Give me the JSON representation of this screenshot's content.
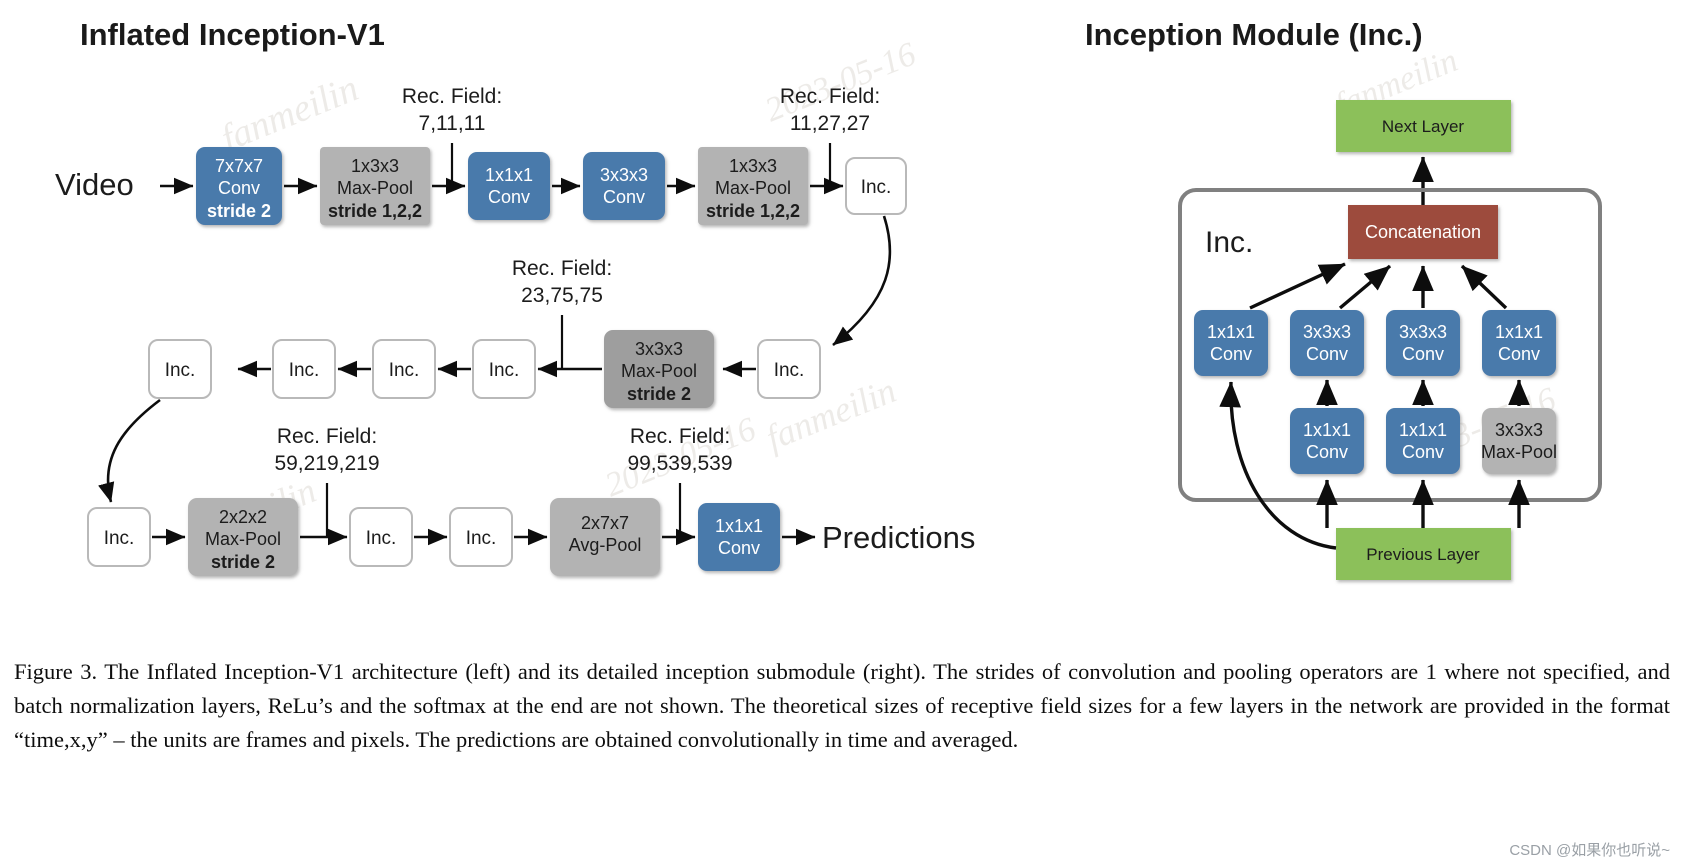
{
  "left_panel": {
    "title": "Inflated Inception-V1",
    "input_label": "Video",
    "output_label": "Predictions",
    "rec_field_caption": "Rec. Field:",
    "rec_fields": [
      {
        "id": "rf1",
        "caption": "Rec. Field:",
        "value": "7,11,11"
      },
      {
        "id": "rf2",
        "caption": "Rec. Field:",
        "value": "11,27,27"
      },
      {
        "id": "rf3",
        "caption": "Rec. Field:",
        "value": "23,75,75"
      },
      {
        "id": "rf4",
        "caption": "Rec. Field:",
        "value": "59,219,219"
      },
      {
        "id": "rf5",
        "caption": "Rec. Field:",
        "value": "99,539,539"
      }
    ],
    "row1": [
      {
        "kind": "conv",
        "l1": "7x7x7",
        "l2": "Conv",
        "l3": "stride 2"
      },
      {
        "kind": "pool",
        "l1": "1x3x3",
        "l2": "Max-Pool",
        "l3": "stride 1,2,2"
      },
      {
        "kind": "conv",
        "l1": "1x1x1",
        "l2": "Conv",
        "l3": ""
      },
      {
        "kind": "conv",
        "l1": "3x3x3",
        "l2": "Conv",
        "l3": ""
      },
      {
        "kind": "pool",
        "l1": "1x3x3",
        "l2": "Max-Pool",
        "l3": "stride 1,2,2"
      },
      {
        "kind": "inc",
        "l1": "Inc.",
        "l2": "",
        "l3": ""
      }
    ],
    "row2": [
      {
        "kind": "inc",
        "l1": "Inc.",
        "l2": "",
        "l3": ""
      },
      {
        "kind": "inc",
        "l1": "Inc.",
        "l2": "",
        "l3": ""
      },
      {
        "kind": "inc",
        "l1": "Inc.",
        "l2": "",
        "l3": ""
      },
      {
        "kind": "inc",
        "l1": "Inc.",
        "l2": "",
        "l3": ""
      },
      {
        "kind": "pool",
        "l1": "3x3x3",
        "l2": "Max-Pool",
        "l3": "stride 2"
      },
      {
        "kind": "inc",
        "l1": "Inc.",
        "l2": "",
        "l3": ""
      }
    ],
    "row3": [
      {
        "kind": "inc",
        "l1": "Inc.",
        "l2": "",
        "l3": ""
      },
      {
        "kind": "pool",
        "l1": "2x2x2",
        "l2": "Max-Pool",
        "l3": "stride 2"
      },
      {
        "kind": "inc",
        "l1": "Inc.",
        "l2": "",
        "l3": ""
      },
      {
        "kind": "inc",
        "l1": "Inc.",
        "l2": "",
        "l3": ""
      },
      {
        "kind": "pool",
        "l1": "2x7x7",
        "l2": "Avg-Pool",
        "l3": ""
      },
      {
        "kind": "conv",
        "l1": "1x1x1",
        "l2": "Conv",
        "l3": ""
      }
    ]
  },
  "right_panel": {
    "title": "Inception Module (Inc.)",
    "next_layer": "Next Layer",
    "previous_layer": "Previous Layer",
    "group_label": "Inc.",
    "concatenation": "Concatenation",
    "top_row": [
      {
        "kind": "conv",
        "l1": "1x1x1",
        "l2": "Conv"
      },
      {
        "kind": "conv",
        "l1": "3x3x3",
        "l2": "Conv"
      },
      {
        "kind": "conv",
        "l1": "3x3x3",
        "l2": "Conv"
      },
      {
        "kind": "conv",
        "l1": "1x1x1",
        "l2": "Conv"
      }
    ],
    "bottom_row": [
      {
        "kind": "conv",
        "l1": "1x1x1",
        "l2": "Conv"
      },
      {
        "kind": "conv",
        "l1": "1x1x1",
        "l2": "Conv"
      },
      {
        "kind": "pool",
        "l1": "3x3x3",
        "l2": "Max-Pool"
      }
    ]
  },
  "caption": "Figure 3. The Inflated Inception-V1 architecture (left) and its detailed inception submodule (right). The strides of convolution and pooling operators are 1 where not specified, and batch normalization layers, ReLu’s and the softmax at the end are not shown.  The theoretical sizes of receptive field sizes for a few layers in the network are provided in the format “time,x,y” – the units are frames and pixels.  The predictions are obtained convolutionally in time and averaged.",
  "watermark": {
    "site": "CSDN @如果你也听说~",
    "marks": [
      "fanmeilin",
      "2023-05-16",
      "fanmeilin",
      "2023-05-16",
      "fanmeilin",
      "2023-05-16",
      "fanmeilin"
    ]
  },
  "colors": {
    "conv_blue": "#4a7aab",
    "pool_gray": "#b3b3b3",
    "pool_gray_dark": "#9e9e9e",
    "inc_white": "#ffffff",
    "inc_border": "#b9b9b9",
    "green": "#8cc05a",
    "concat_red": "#9d4c3c",
    "group_border": "#808080",
    "arrow": "#0d0d0d",
    "text_dark": "#1c1c1c"
  }
}
